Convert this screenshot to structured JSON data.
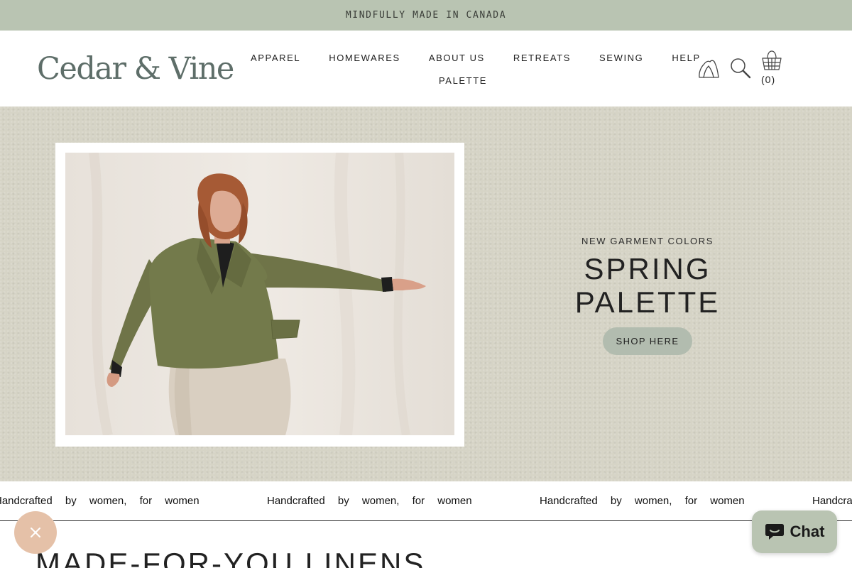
{
  "announcement": "MINDFULLY MADE IN CANADA",
  "logo": "Cedar & Vine",
  "nav": {
    "row1": [
      "APPAREL",
      "HOMEWARES",
      "ABOUT US",
      "RETREATS",
      "SEWING",
      "HELP"
    ],
    "row2": [
      "PALETTE"
    ]
  },
  "icons": {
    "profile": "profile-icon",
    "search": "search-icon",
    "cart": "cart-basket-icon",
    "close": "close-icon",
    "chat": "chat-bubble-icon"
  },
  "cart": {
    "count_label": "(0)"
  },
  "hero": {
    "kicker": "NEW GARMENT COLORS",
    "title_line1": "SPRING",
    "title_line2": "PALETTE",
    "cta": "SHOP HERE"
  },
  "ticker": {
    "items": [
      "Handcrafted by women, for women",
      "Handcrafted by women, for women",
      "Handcrafted by women, for women",
      "Handcrafted by women, for women"
    ]
  },
  "section": {
    "title": "MADE-FOR-YOU LINENS"
  },
  "chat": {
    "label": "Chat"
  },
  "colors": {
    "announcement_bg": "#b9c4b2",
    "logo": "#5e6e69",
    "hero_bg": "#d6d4c6",
    "cta_bg": "#b2bcaf",
    "close_fab": "#e5c1a8",
    "jacket": "#6f7448"
  }
}
